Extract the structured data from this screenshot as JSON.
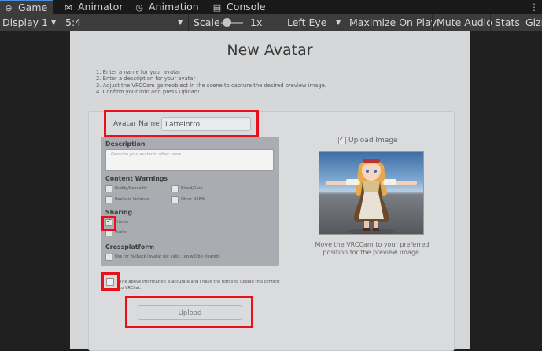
{
  "tabs": [
    {
      "label": "Game",
      "icon": "gamepad-icon",
      "active": true
    },
    {
      "label": "Animator",
      "icon": "animator-icon",
      "active": false
    },
    {
      "label": "Animation",
      "icon": "clock-icon",
      "active": false
    },
    {
      "label": "Console",
      "icon": "console-icon",
      "active": false
    }
  ],
  "toolbar": {
    "display": "Display 1",
    "aspect": "5:4",
    "scale_label": "Scale",
    "scale_value": "1x",
    "eye": "Left Eye",
    "maximize": "Maximize On Play",
    "mute": "Mute Audio",
    "stats": "Stats",
    "gizmos": "Gizmos"
  },
  "panel": {
    "title": "New Avatar",
    "instructions": [
      "1. Enter a name for your avatar",
      "2. Enter a description for your avatar",
      "3. Adjust the VRCCam gameobject in the scene to capture the desired preview image.",
      "4. Confirm your info and press Upload!"
    ],
    "avatar_name_label": "Avatar Name",
    "avatar_name_value": "LatteIntro",
    "description_title": "Description",
    "description_placeholder": "Describe your avatar to other users...",
    "content_warnings_title": "Content Warnings",
    "content_warnings": [
      {
        "label": "Nudity/Sexuality",
        "checked": false
      },
      {
        "label": "Blood/Gore",
        "checked": false
      },
      {
        "label": "Realistic Violence",
        "checked": false
      },
      {
        "label": "Other NSFW",
        "checked": false
      }
    ],
    "sharing_title": "Sharing",
    "sharing": [
      {
        "label": "Private",
        "checked": true
      },
      {
        "label": "Public",
        "checked": false
      }
    ],
    "crossplatform_title": "Crossplatform",
    "crossplatform_option": "Use for Fallback (avatar not valid, tag will be cleared)",
    "rights_line1": "The above information is accurate and I have the rights to upload this content",
    "rights_line2": "to VRChat.",
    "upload_button": "Upload",
    "upload_image_label": "Upload Image",
    "upload_image_checked": true,
    "preview_caption_line1": "Move the VRCCam to your preferred",
    "preview_caption_line2": "position for the preview image."
  },
  "colors": {
    "highlight": "#e8101a",
    "tab_accent": "#4a90d9",
    "panel_bg": "#d6d7d9",
    "form_bg": "#a9acb0"
  }
}
